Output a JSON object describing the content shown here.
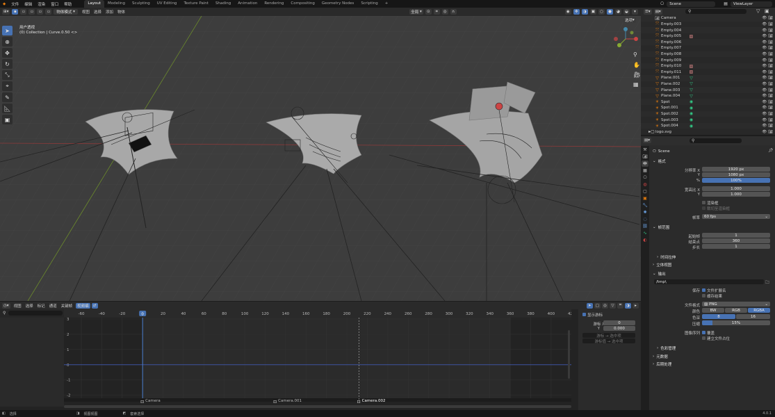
{
  "menu": [
    "文件",
    "编辑",
    "渲染",
    "窗口",
    "帮助"
  ],
  "workspaces": [
    {
      "label": "Layout",
      "active": true
    },
    {
      "label": "Modeling"
    },
    {
      "label": "Sculpting"
    },
    {
      "label": "UV Editing"
    },
    {
      "label": "Texture Paint"
    },
    {
      "label": "Shading"
    },
    {
      "label": "Animation"
    },
    {
      "label": "Rendering"
    },
    {
      "label": "Compositing"
    },
    {
      "label": "Geometry Nodes"
    },
    {
      "label": "Scripting"
    },
    {
      "label": "+"
    }
  ],
  "scene": {
    "scene_name": "Scene",
    "viewlayer_name": "ViewLayer"
  },
  "viewport": {
    "mode": "物体模式",
    "menus": [
      "视图",
      "选择",
      "添加",
      "物体"
    ],
    "transform": "全局",
    "view_name": "用户透视",
    "collection_info": "(0) Collection | Curve.0.50 <>",
    "options_label": "选项"
  },
  "timeline": {
    "menus": [
      "视图",
      "选择",
      "标记",
      "通道",
      "关键帧"
    ],
    "filter_label": "视频编",
    "current_frame": "0",
    "frame_ticks": [
      "-60",
      "-40",
      "-20",
      "0",
      "20",
      "40",
      "60",
      "80",
      "100",
      "120",
      "140",
      "160",
      "180",
      "200",
      "220",
      "240",
      "260",
      "280",
      "300",
      "320",
      "340",
      "360",
      "380",
      "400",
      "420"
    ],
    "y_ticks": [
      "3",
      "2",
      "1",
      "0",
      "-1",
      "-2"
    ],
    "markers": [
      "Camera",
      "Camera.001",
      "Camera.002"
    ],
    "panel": {
      "title": "显示游标",
      "x_label": "游标 X",
      "x_value": "0",
      "y_label": "Y",
      "y_value": "0.000",
      "btn1": "游标 → 选中项",
      "btn2": "游标值 → 选中项"
    }
  },
  "statusbar": {
    "items": [
      "选择",
      "视图视图",
      "套索选择"
    ],
    "version": "4.0.1"
  },
  "outliner": {
    "rows": [
      {
        "name": "Camera",
        "type": "camera"
      },
      {
        "name": "Empty.003",
        "type": "empty"
      },
      {
        "name": "Empty.004",
        "type": "empty"
      },
      {
        "name": "Empty.005",
        "type": "empty"
      },
      {
        "name": "Empty.006",
        "type": "empty"
      },
      {
        "name": "Empty.007",
        "type": "empty"
      },
      {
        "name": "Empty.008",
        "type": "empty"
      },
      {
        "name": "Empty.009",
        "type": "empty"
      },
      {
        "name": "Empty.010",
        "type": "empty"
      },
      {
        "name": "Empty.011",
        "type": "empty"
      },
      {
        "name": "Plane.001",
        "type": "mesh"
      },
      {
        "name": "Plane.002",
        "type": "mesh"
      },
      {
        "name": "Plane.003",
        "type": "mesh"
      },
      {
        "name": "Plane.004",
        "type": "mesh"
      },
      {
        "name": "Spot",
        "type": "light"
      },
      {
        "name": "Spot.001",
        "type": "light"
      },
      {
        "name": "Spot.002",
        "type": "light"
      },
      {
        "name": "Spot.003",
        "type": "light"
      },
      {
        "name": "Spot.004",
        "type": "light"
      },
      {
        "name": "logo.svg",
        "type": "collection"
      }
    ]
  },
  "properties": {
    "scene_label": "Scene",
    "format_section": "格式",
    "res_x_label": "分辨率 X",
    "res_x": "1920 px",
    "res_y_label": "Y",
    "res_y": "1080 px",
    "res_pct_label": "%",
    "res_pct": "100%",
    "aspect_x_label": "宽高比 X",
    "aspect_x": "1.000",
    "aspect_y_label": "Y",
    "aspect_y": "1.000",
    "render_region": "渲染框",
    "crop_region": "裁切至渲染框",
    "fps_label": "帧率",
    "fps": "60 fps",
    "frame_range_section": "帧范围",
    "frame_start_label": "起始帧",
    "frame_start": "1",
    "frame_end_label": "结束点",
    "frame_end": "360",
    "step_label": "步长",
    "step": "1",
    "time_stretch": "时间拉伸",
    "stereo": "立体视图",
    "output_section": "输出",
    "output_path": "/tmp\\",
    "saving_label": "保存",
    "file_ext": "文件扩展名",
    "cache_result": "缓存结果",
    "file_format_label": "文件格式",
    "file_format": "PNG",
    "color_label": "颜色",
    "bw": "BW",
    "rgb": "RGB",
    "rgba": "RGBA",
    "depth_label": "色深",
    "depth_8": "8",
    "depth_16": "16",
    "compression_label": "压缩",
    "compression": "15%",
    "seq_label": "图像序列",
    "overwrite": "覆盖",
    "placeholders": "建立文件占位",
    "color_mgmt": "色彩管理",
    "metadata": "元数据",
    "post_processing": "后期处理"
  },
  "colors": {
    "accent": "#4772b3",
    "viewport": "#3d3d3d",
    "x_axis": "#8b3a3a",
    "y_axis": "#6b8a2c"
  }
}
